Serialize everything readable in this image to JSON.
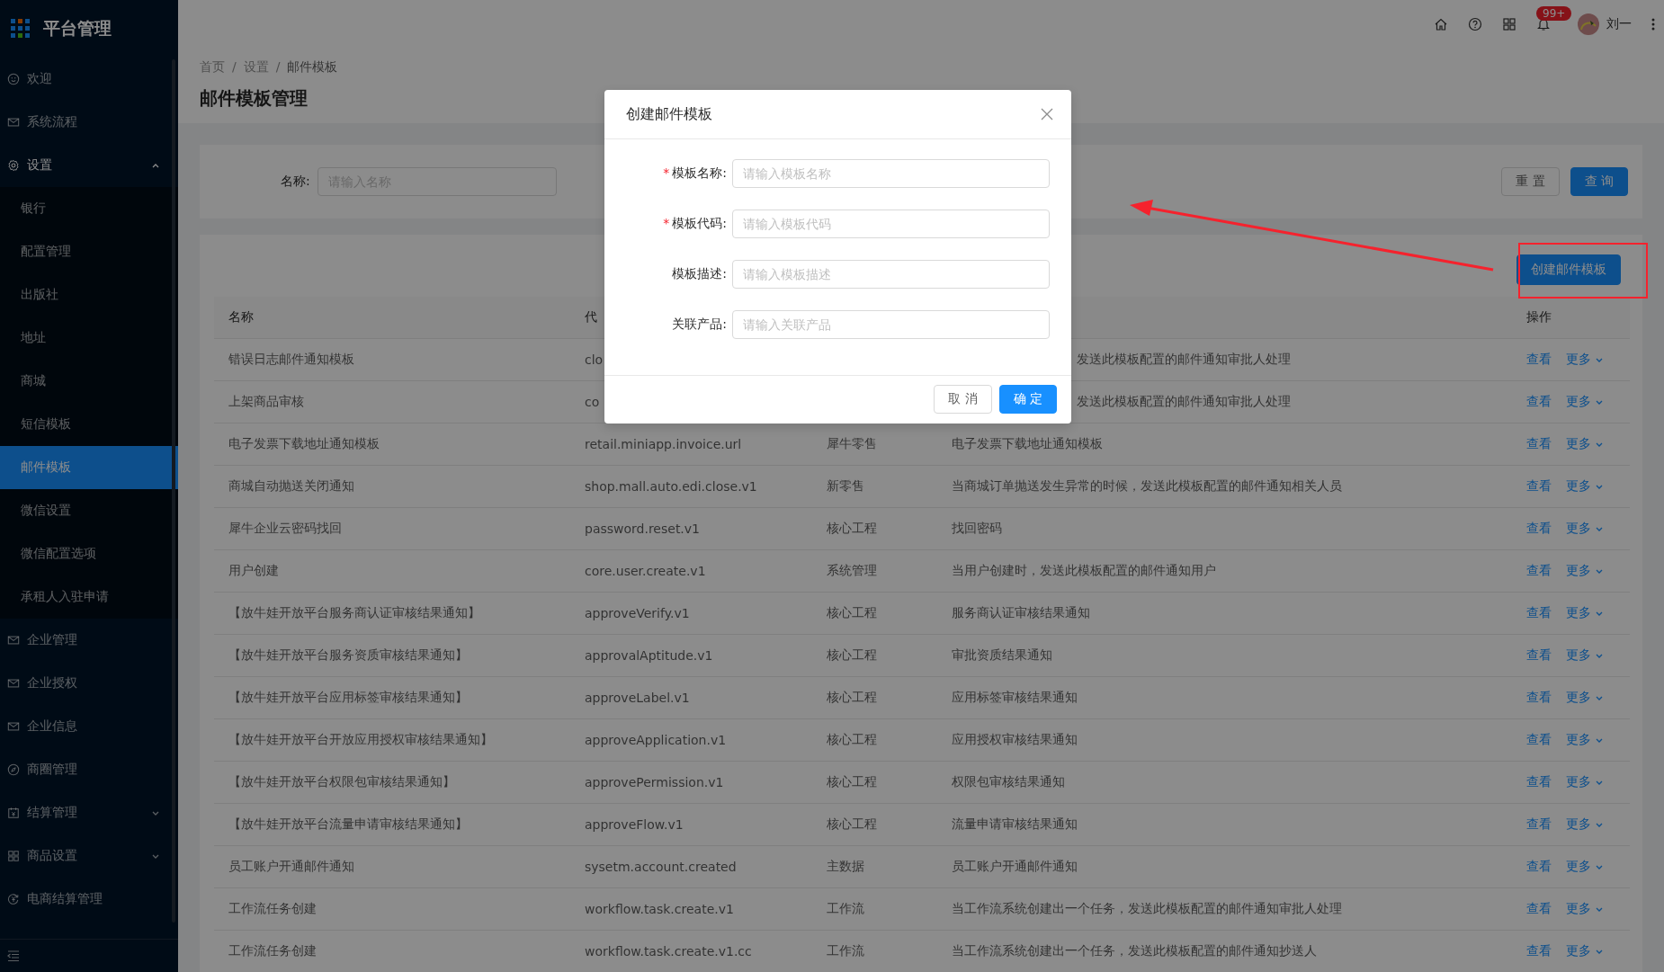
{
  "app": {
    "title": "平台管理"
  },
  "sidebar": {
    "items": [
      {
        "label": "欢迎",
        "selected": false
      },
      {
        "label": "系统流程",
        "selected": false
      },
      {
        "label": "设置",
        "selected": false,
        "expanded": true,
        "children": [
          {
            "label": "银行",
            "selected": false
          },
          {
            "label": "配置管理",
            "selected": false
          },
          {
            "label": "出版社",
            "selected": false
          },
          {
            "label": "地址",
            "selected": false
          },
          {
            "label": "商城",
            "selected": false
          },
          {
            "label": "短信模板",
            "selected": false
          },
          {
            "label": "邮件模板",
            "selected": true
          },
          {
            "label": "微信设置",
            "selected": false
          },
          {
            "label": "微信配置选项",
            "selected": false
          },
          {
            "label": "承租人入驻申请",
            "selected": false
          }
        ]
      },
      {
        "label": "企业管理",
        "selected": false
      },
      {
        "label": "企业授权",
        "selected": false
      },
      {
        "label": "企业信息",
        "selected": false
      },
      {
        "label": "商圈管理",
        "selected": false
      },
      {
        "label": "结算管理",
        "selected": false,
        "expanded": false
      },
      {
        "label": "商品设置",
        "selected": false,
        "expanded": false
      },
      {
        "label": "电商结算管理",
        "selected": false
      }
    ]
  },
  "header": {
    "notification_count": "99+",
    "user_name": "刘一"
  },
  "breadcrumb": [
    "首页",
    "设置",
    "邮件模板"
  ],
  "breadcrumb_separator": "/",
  "page_title": "邮件模板管理",
  "search": {
    "label": "名称:",
    "placeholder": "请输入名称",
    "buttons": [
      "重 置",
      "查 询"
    ]
  },
  "create_button": "创建邮件模板",
  "table": {
    "columns": [
      "名称",
      "代",
      "操作"
    ],
    "rows": [
      {
        "name": "错误日志邮件通知模板",
        "code": "clo",
        "description": "发送此模板配置的邮件通知审批人处理",
        "actions": [
          "查看",
          "更多"
        ]
      },
      {
        "name": "上架商品审核",
        "code": "co",
        "description": "发送此模板配置的邮件通知审批人处理",
        "actions": [
          "查看",
          "更多"
        ]
      },
      {
        "name": "电子发票下载地址通知模板",
        "code": "retail.miniapp.invoice.url",
        "category": "犀牛零售",
        "description": "电子发票下载地址通知模板",
        "actions": [
          "查看",
          "更多"
        ]
      },
      {
        "name": "商城自动抛送关闭通知",
        "code": "shop.mall.auto.edi.close.v1",
        "category": "新零售",
        "description": "当商城订单抛送发生异常的时候，发送此模板配置的邮件通知相关人员",
        "actions": [
          "查看",
          "更多"
        ]
      },
      {
        "name": "犀牛企业云密码找回",
        "code": "password.reset.v1",
        "category": "核心工程",
        "description": "找回密码",
        "actions": [
          "查看",
          "更多"
        ]
      },
      {
        "name": "用户创建",
        "code": "core.user.create.v1",
        "category": "系统管理",
        "description": "当用户创建时，发送此模板配置的邮件通知用户",
        "actions": [
          "查看",
          "更多"
        ]
      },
      {
        "name": "【放牛娃开放平台服务商认证审核结果通知】",
        "code": "approveVerify.v1",
        "category": "核心工程",
        "description": "服务商认证审核结果通知",
        "actions": [
          "查看",
          "更多"
        ]
      },
      {
        "name": "【放牛娃开放平台服务资质审核结果通知】",
        "code": "approvalAptitude.v1",
        "category": "核心工程",
        "description": "审批资质结果通知",
        "actions": [
          "查看",
          "更多"
        ]
      },
      {
        "name": "【放牛娃开放平台应用标签审核结果通知】",
        "code": "approveLabel.v1",
        "category": "核心工程",
        "description": "应用标签审核结果通知",
        "actions": [
          "查看",
          "更多"
        ]
      },
      {
        "name": "【放牛娃开放平台开放应用授权审核结果通知】",
        "code": "approveApplication.v1",
        "category": "核心工程",
        "description": "应用授权审核结果通知",
        "actions": [
          "查看",
          "更多"
        ]
      },
      {
        "name": "【放牛娃开放平台权限包审核结果通知】",
        "code": "approvePermission.v1",
        "category": "核心工程",
        "description": "权限包审核结果通知",
        "actions": [
          "查看",
          "更多"
        ]
      },
      {
        "name": "【放牛娃开放平台流量申请审核结果通知】",
        "code": "approveFlow.v1",
        "category": "核心工程",
        "description": "流量申请审核结果通知",
        "actions": [
          "查看",
          "更多"
        ]
      },
      {
        "name": "员工账户开通邮件通知",
        "code": "sysetm.account.created",
        "category": "主数据",
        "description": "员工账户开通邮件通知",
        "actions": [
          "查看",
          "更多"
        ]
      },
      {
        "name": "工作流任务创建",
        "code": "workflow.task.create.v1",
        "category": "工作流",
        "description": "当工作流系统创建出一个任务，发送此模板配置的邮件通知审批人处理",
        "actions": [
          "查看",
          "更多"
        ]
      },
      {
        "name": "工作流任务创建",
        "code": "workflow.task.create.v1.cc",
        "category": "工作流",
        "description": "当工作流系统创建出一个任务，发送此模板配置的邮件通知抄送人",
        "actions": [
          "查看",
          "更多"
        ]
      }
    ]
  },
  "modal": {
    "title": "创建邮件模板",
    "fields": [
      {
        "label": "模板名称:",
        "required": true,
        "placeholder": "请输入模板名称"
      },
      {
        "label": "模板代码:",
        "required": true,
        "placeholder": "请输入模板代码"
      },
      {
        "label": "模板描述:",
        "required": false,
        "placeholder": "请输入模板描述"
      },
      {
        "label": "关联产品:",
        "required": false,
        "placeholder": "请输入关联产品"
      }
    ],
    "required_mark": "*",
    "buttons": [
      {
        "label": "取 消",
        "kind": "default"
      },
      {
        "label": "确 定",
        "kind": "primary"
      }
    ]
  }
}
